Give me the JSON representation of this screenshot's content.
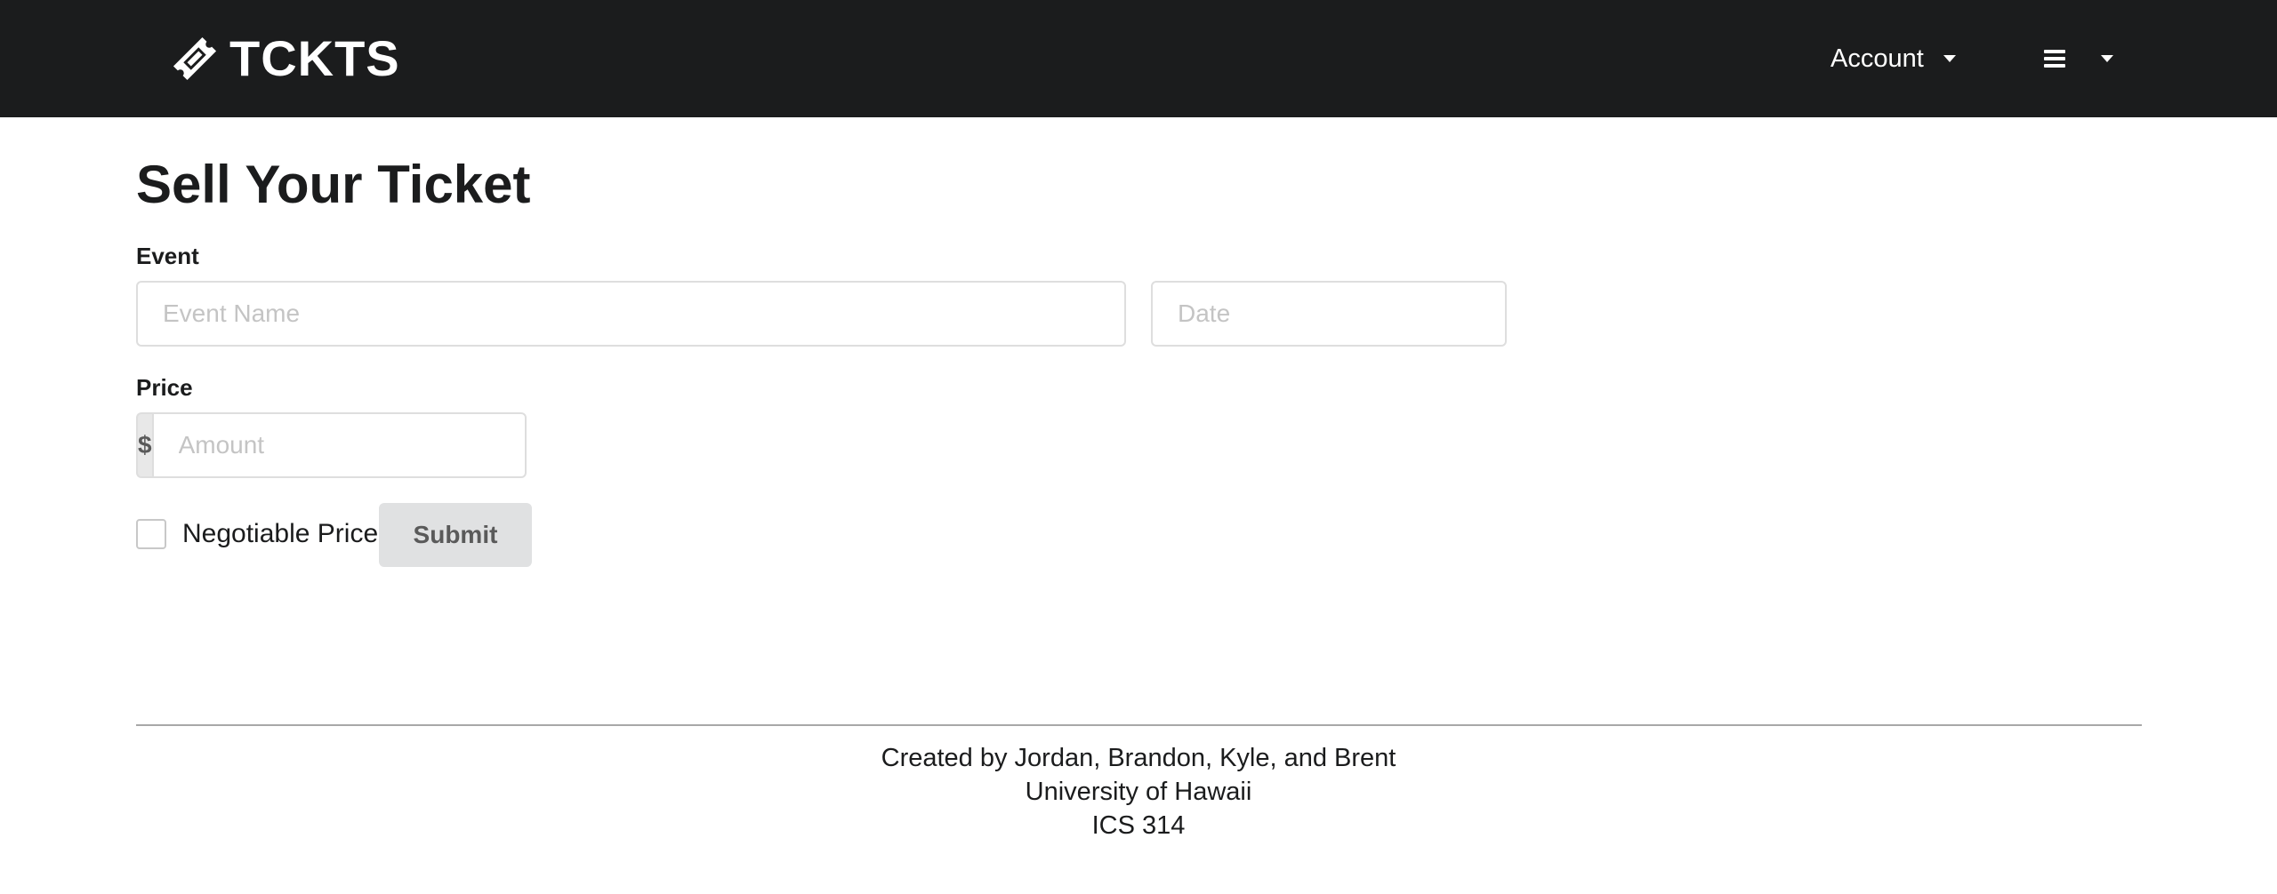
{
  "navbar": {
    "brand": {
      "icon": "ticket-icon",
      "label": "TCKTS"
    },
    "account": {
      "label": "Account",
      "icon": "caret-down-icon"
    },
    "menu": {
      "icon": "hamburger-menu-icon",
      "caret_icon": "caret-down-icon"
    }
  },
  "page": {
    "title": "Sell Your Ticket"
  },
  "form": {
    "event": {
      "label": "Event",
      "name_placeholder": "Event Name",
      "name_value": "",
      "date_placeholder": "Date",
      "date_value": ""
    },
    "price": {
      "label": "Price",
      "currency_symbol": "$",
      "amount_placeholder": "Amount",
      "amount_value": ""
    },
    "negotiable": {
      "label": "Negotiable Price?",
      "checked": false
    },
    "submit_label": "Submit"
  },
  "footer": {
    "lines": [
      "Created by Jordan, Brandon, Kyle, and Brent",
      "University of Hawaii",
      "ICS 314"
    ]
  },
  "colors": {
    "navbar_bg": "#1b1c1d",
    "text": "#1b1c1d",
    "button_bg": "#e0e1e2",
    "input_border": "#dedede",
    "placeholder": "#c4c4c4"
  }
}
